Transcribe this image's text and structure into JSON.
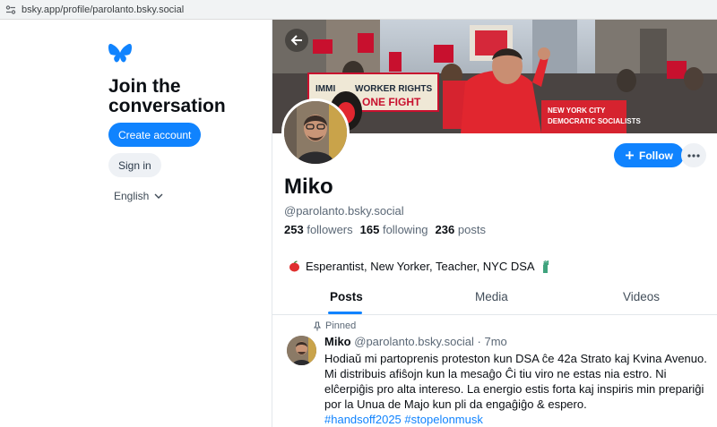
{
  "browser": {
    "url": "bsky.app/profile/parolanto.bsky.social"
  },
  "sidebar": {
    "heading": "Join the conversation",
    "create_account": "Create account",
    "sign_in": "Sign in",
    "language": "English"
  },
  "banner": {
    "signs": [
      "WORKER RIGHTS",
      "ONE FIGHT",
      "NEW YORK CITY",
      "DEMOCRATIC SOCIALISTS",
      "IMMI"
    ]
  },
  "profile": {
    "name": "Miko",
    "handle": "@parolanto.bsky.social",
    "followers_count": "253",
    "followers_label": "followers",
    "following_count": "165",
    "following_label": "following",
    "posts_count": "236",
    "posts_label": "posts",
    "bio": "Esperantist, New Yorker, Teacher, NYC DSA",
    "follow_label": "Follow"
  },
  "tabs": [
    {
      "label": "Posts",
      "active": true
    },
    {
      "label": "Media",
      "active": false
    },
    {
      "label": "Videos",
      "active": false
    }
  ],
  "post": {
    "pinned_label": "Pinned",
    "author": "Miko",
    "handle": "@parolanto.bsky.social",
    "separator": "·",
    "time": "7mo",
    "text": "Hodiaŭ mi partoprenis proteston kun DSA ĉe 42a Strato kaj Kvina Avenuo. Mi distribuis afiŝojn kun la mesaĝo Ĉi tiu viro ne estas nia estro. Ni elĉerpiĝis pro alta intereso. La energio estis forta kaj inspiris min prepariĝi por la Unua de Majo kun pli da engaĝiĝo & espero.",
    "hashtags": [
      "#handsoff2025",
      "#stopelonmusk"
    ]
  },
  "colors": {
    "accent": "#1083fe",
    "muted": "#5b6876",
    "banner_red": "#c8102e"
  },
  "icons": [
    "site-settings-icon",
    "butterfly-logo-icon",
    "chevron-down-icon",
    "back-arrow-icon",
    "plus-icon",
    "ellipsis-icon",
    "pin-icon",
    "apple-emoji-icon",
    "statue-of-liberty-emoji-icon"
  ]
}
